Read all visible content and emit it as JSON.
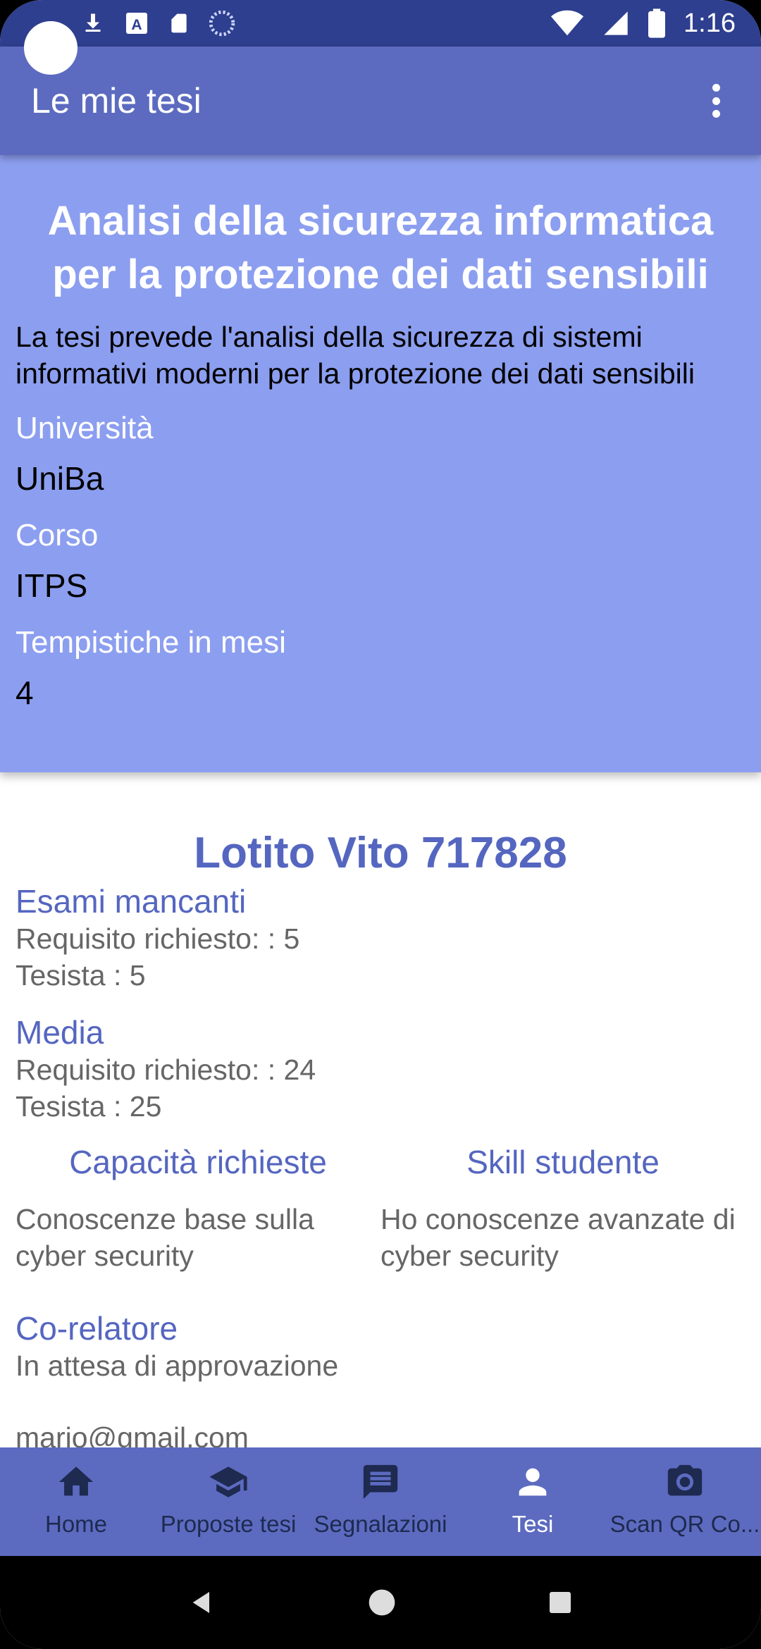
{
  "status_bar": {
    "time": "1:16"
  },
  "app_bar": {
    "title": "Le mie tesi"
  },
  "thesis": {
    "title": "Analisi della sicurezza informatica per la protezione dei dati sensibili",
    "description": "La tesi prevede l'analisi della sicurezza di sistemi informativi moderni per la protezione dei dati sensibili",
    "university_label": "Università",
    "university_value": "UniBa",
    "course_label": "Corso",
    "course_value": "ITPS",
    "duration_label": "Tempistiche in mesi",
    "duration_value": "4"
  },
  "student": {
    "name": "Lotito Vito 717828",
    "exams_title": "Esami mancanti",
    "exams_required": "Requisito richiesto: : 5",
    "exams_student": "Tesista : 5",
    "average_title": "Media",
    "average_required": "Requisito richiesto: : 24",
    "average_student": "Tesista : 25",
    "required_skills_title": "Capacità richieste",
    "required_skills_text": "Conoscenze base sulla cyber security",
    "student_skills_title": "Skill studente",
    "student_skills_text": "Ho conoscenze avanzate di cyber security",
    "corelator_title": "Co-relatore",
    "corelator_status": "In attesa di approvazione",
    "email": "mario@gmail.com"
  },
  "bottom_nav": {
    "items": [
      {
        "label": "Home",
        "icon": "home-icon",
        "active": false
      },
      {
        "label": "Proposte tesi",
        "icon": "school-icon",
        "active": false
      },
      {
        "label": "Segnalazioni",
        "icon": "message-icon",
        "active": false
      },
      {
        "label": "Tesi",
        "icon": "person-icon",
        "active": true
      },
      {
        "label": "Scan QR Co...",
        "icon": "camera-icon",
        "active": false
      }
    ]
  },
  "colors": {
    "status_bar": "#2e3f8f",
    "app_bar": "#5c6bc0",
    "card": "#8c9eef",
    "accent_text": "#5566c0"
  }
}
